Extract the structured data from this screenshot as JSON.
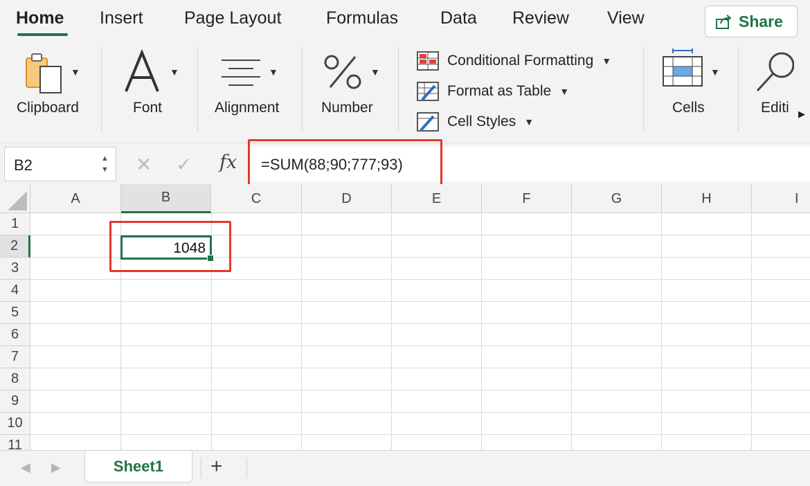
{
  "tabs": [
    "Home",
    "Insert",
    "Page Layout",
    "Formulas",
    "Data",
    "Review",
    "View"
  ],
  "active_tab": "Home",
  "share_label": "Share",
  "ribbon": {
    "clipboard": "Clipboard",
    "font": "Font",
    "alignment": "Alignment",
    "number": "Number",
    "conditional_formatting": "Conditional Formatting",
    "format_as_table": "Format as Table",
    "cell_styles": "Cell Styles",
    "cells": "Cells",
    "editing": "Editi"
  },
  "formula_bar": {
    "name_box": "B2",
    "fx": "fx",
    "formula": "=SUM(88;90;777;93)"
  },
  "grid": {
    "columns": [
      "A",
      "B",
      "C",
      "D",
      "E",
      "F",
      "G",
      "H",
      "I"
    ],
    "rows": [
      "1",
      "2",
      "3",
      "4",
      "5",
      "6",
      "7",
      "8",
      "9",
      "10",
      "11"
    ],
    "selected_column": "B",
    "selected_row": "2",
    "active_cell": {
      "ref": "B2",
      "value": "1048"
    }
  },
  "sheets": {
    "active": "Sheet1",
    "add_label": "+"
  },
  "colors": {
    "accent": "#217346",
    "highlight": "#e8352a"
  }
}
